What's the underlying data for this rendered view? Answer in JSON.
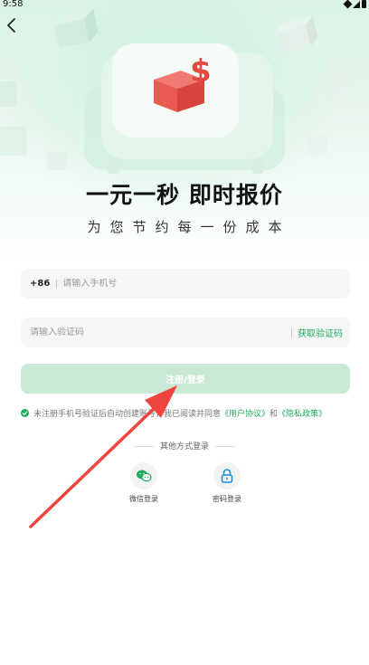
{
  "status": {
    "time": "9:58"
  },
  "hero": {
    "headline": "一元一秒 即时报价",
    "subhead": "为您节约每一份成本"
  },
  "phone": {
    "country_code": "+86",
    "placeholder": "请输入手机号"
  },
  "code": {
    "placeholder": "请输入验证码",
    "get_code_label": "获取验证码"
  },
  "submit": {
    "label": "注册/登录"
  },
  "agreement": {
    "prefix": "未注册手机号验证后自动创建账号，我已阅读并同意",
    "user_agreement": "《用户协议》",
    "and": "和",
    "privacy_policy": "《隐私政策》"
  },
  "other_login": {
    "title": "其他方式登录",
    "options": [
      {
        "label": "微信登录",
        "icon": "wechat-icon"
      },
      {
        "label": "密码登录",
        "icon": "lock-icon"
      }
    ]
  },
  "colors": {
    "accent": "#1eab5c",
    "button_disabled": "#c9e8d5",
    "arrow": "#f0453f"
  }
}
